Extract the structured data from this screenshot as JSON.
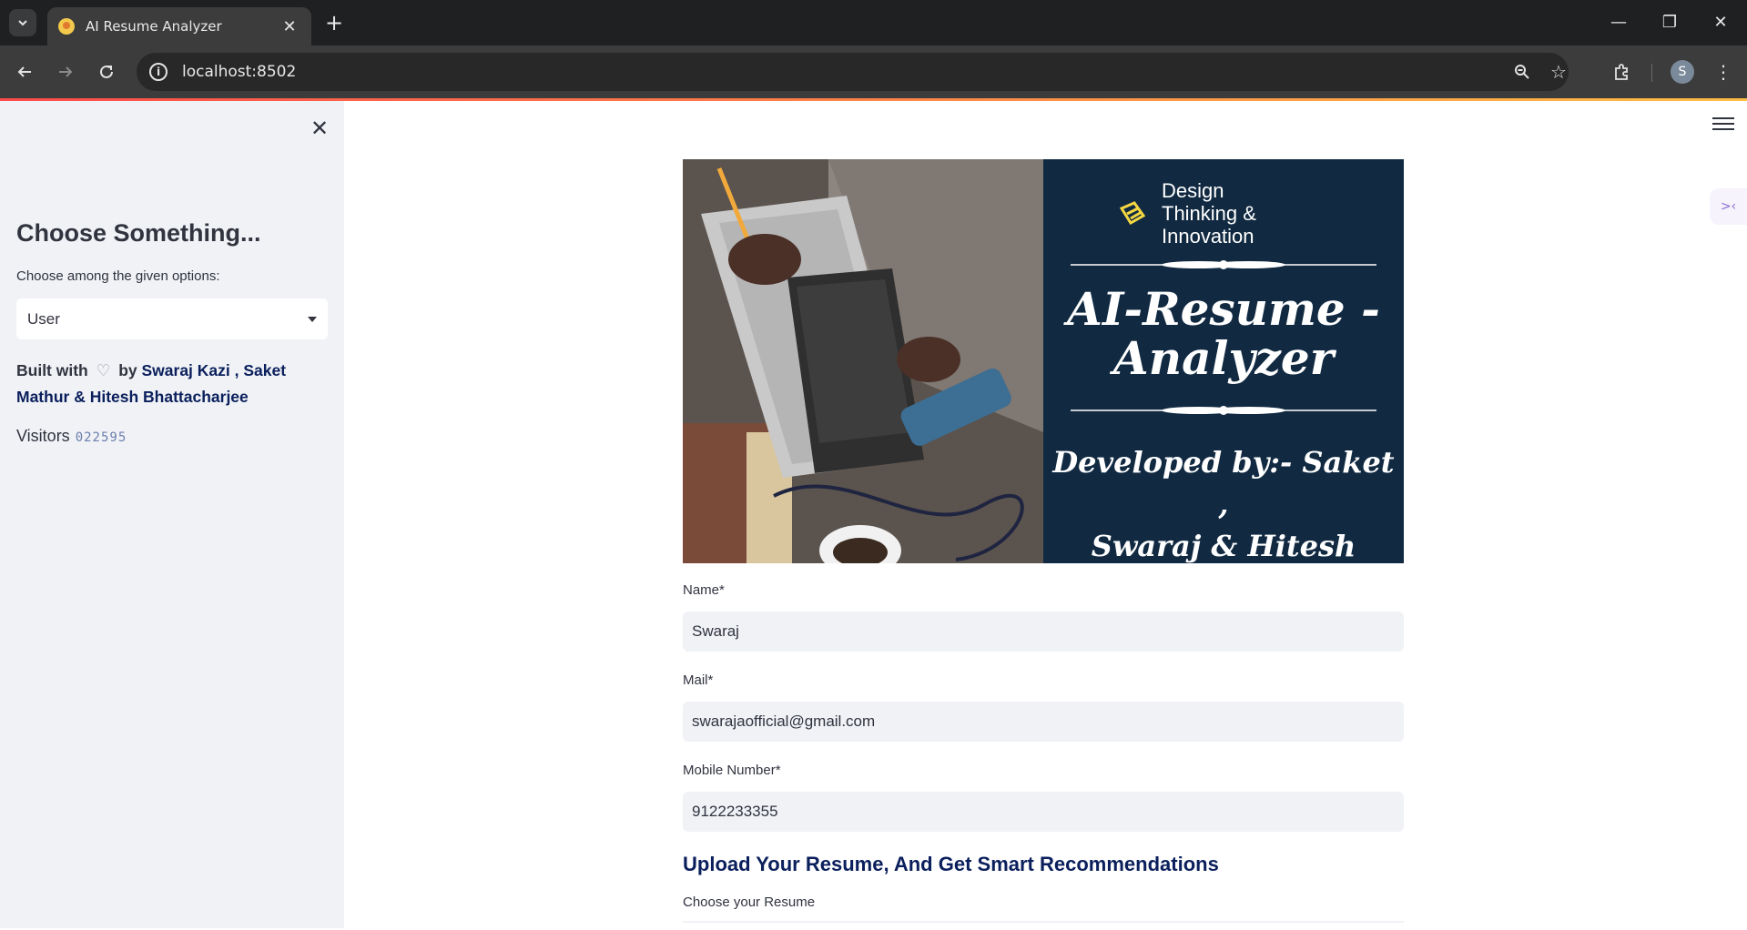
{
  "browser": {
    "tab_title": "AI Resume Analyzer",
    "url": "localhost:8502",
    "profile_initial": "S"
  },
  "sidebar": {
    "title": "Choose Something...",
    "select_label": "Choose among the given options:",
    "select_value": "User",
    "built_prefix": "Built with",
    "built_by": "by",
    "authors": "Swaraj Kazi , Saket Mathur & Hitesh Bhattacharjee",
    "visitors_label": "Visitors",
    "visitors_count": "022595"
  },
  "banner": {
    "brand_line1": "Design",
    "brand_line2": "Thinking &",
    "brand_line3": "Innovation",
    "title_line1": "AI-Resume -",
    "title_line2": "Analyzer",
    "dev_line1": "Developed by:- Saket ,",
    "dev_line2": "Swaraj & Hitesh",
    "accent_color": "#112a42"
  },
  "form": {
    "name_label": "Name*",
    "name_value": "Swaraj",
    "mail_label": "Mail*",
    "mail_value": "swarajaofficial@gmail.com",
    "mobile_label": "Mobile Number*",
    "mobile_value": "9122233355",
    "upload_heading": "Upload Your Resume, And Get Smart Recommendations",
    "upload_label": "Choose your Resume"
  },
  "colors": {
    "heading_blue": "#0a1f5c",
    "sidebar_bg": "#f0f2f6"
  }
}
